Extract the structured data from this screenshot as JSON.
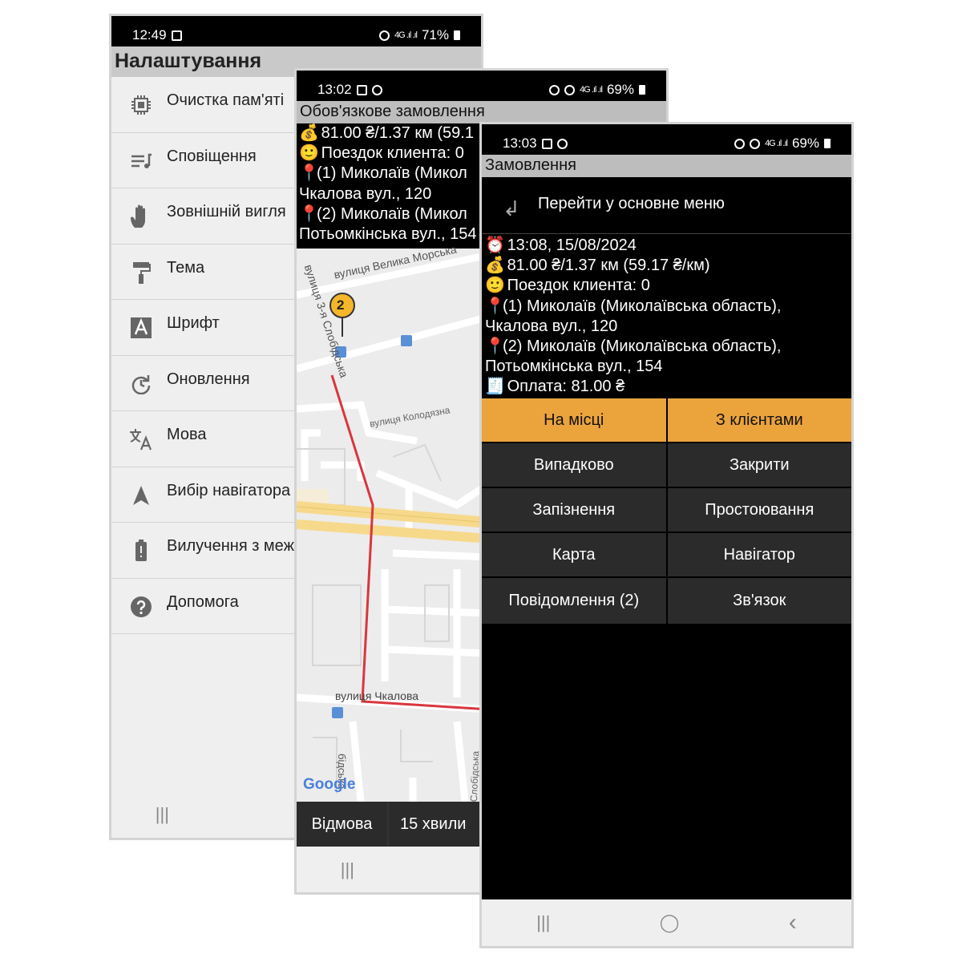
{
  "settings_screen": {
    "status": {
      "time": "12:49",
      "battery": "71%"
    },
    "title": "Налаштування",
    "items": [
      {
        "label": "Очистка пам'яті",
        "icon": "chip-icon"
      },
      {
        "label": "Сповіщення",
        "icon": "notification-icon"
      },
      {
        "label": "Зовнішній вигля",
        "icon": "hand-icon"
      },
      {
        "label": "Тема",
        "icon": "paint-roller-icon"
      },
      {
        "label": "Шрифт",
        "icon": "font-icon"
      },
      {
        "label": "Оновлення",
        "icon": "update-icon"
      },
      {
        "label": "Мова",
        "icon": "translate-icon"
      },
      {
        "label": "Вибір навігатора",
        "icon": "navigation-arrow-icon"
      },
      {
        "label": "Вилучення з меж",
        "icon": "battery-icon"
      },
      {
        "label": "Допомога",
        "icon": "help-icon"
      }
    ],
    "nav": {
      "recent": "|||",
      "home": "◯"
    }
  },
  "mandatory_order_screen": {
    "status": {
      "time": "13:02",
      "battery": "69%"
    },
    "title": "Обов'язкове замовлення",
    "info": {
      "price": "81.00 ₴/1.37 км (59.1",
      "trips": "Поездок клиента: 0",
      "point1_a": "(1) Миколаїв (Микол",
      "point1_b": "Чкалова вул., 120",
      "point2_a": "(2) Миколаїв (Микол",
      "point2_b": "Потьомкінська вул., 154"
    },
    "map": {
      "street1": "вулиця Велика Морська",
      "street2": "вулиця 3-я Слобідська",
      "street3": "вулиця Колодязна",
      "street4": "вулиця Чкалова",
      "street5": "Слобідська",
      "street6": "бідська",
      "marker_label": "2",
      "logo": "Google"
    },
    "buttons": {
      "refuse": "Відмова",
      "wait": "15 хвили"
    },
    "nav": {
      "recent": "|||",
      "home": "◯"
    }
  },
  "order_screen": {
    "status": {
      "time": "13:03",
      "battery": "69%"
    },
    "title": "Замовлення",
    "back_label": "Перейти у основне меню",
    "info": {
      "datetime": "13:08, 15/08/2024",
      "price": "81.00 ₴/1.37 км (59.17 ₴/км)",
      "trips": "Поездок клиента: 0",
      "point1_a": "(1) Миколаїв (Миколаївська область),",
      "point1_b": "Чкалова вул., 120",
      "point2_a": "(2) Миколаїв (Миколаївська область),",
      "point2_b": "Потьомкінська вул., 154",
      "payment": "Оплата: 81.00 ₴"
    },
    "buttons": {
      "on_place": "На місці",
      "with_clients": "З клієнтами",
      "random": "Випадково",
      "close": "Закрити",
      "late": "Запізнення",
      "idle": "Простоювання",
      "map": "Карта",
      "navigator": "Навігатор",
      "messages": "Повідомлення   (2)",
      "contact": "Зв'язок"
    },
    "nav": {
      "recent": "|||",
      "home": "◯",
      "back": "‹"
    }
  },
  "colors": {
    "accent": "#eba33c",
    "button_bg": "#2b2b2b",
    "route": "#d9363e"
  }
}
